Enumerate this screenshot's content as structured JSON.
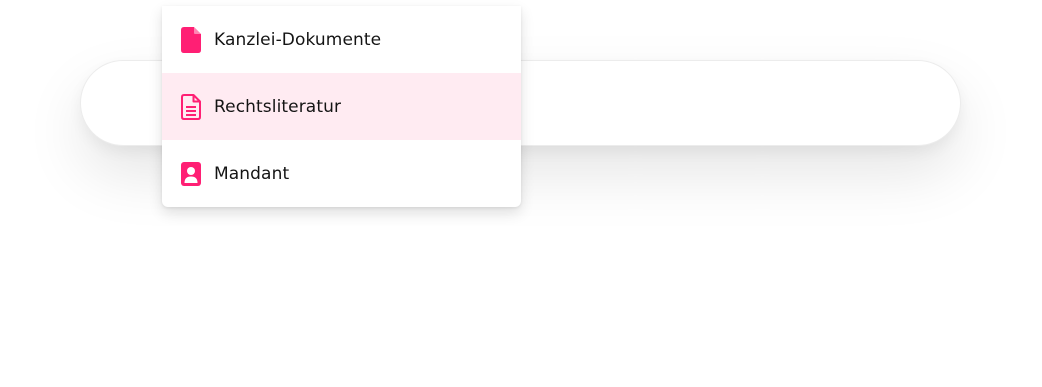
{
  "theme": {
    "accent": "#ff1f74",
    "active_background": "#ffebf2",
    "text": "#141414"
  },
  "search": {
    "value": ""
  },
  "dropdown": {
    "active_index": 1,
    "items": [
      {
        "label": "Kanzlei-Dokumente",
        "icon": "document-icon"
      },
      {
        "label": "Rechtsliteratur",
        "icon": "document-lines-icon"
      },
      {
        "label": "Mandant",
        "icon": "client-icon"
      }
    ]
  }
}
